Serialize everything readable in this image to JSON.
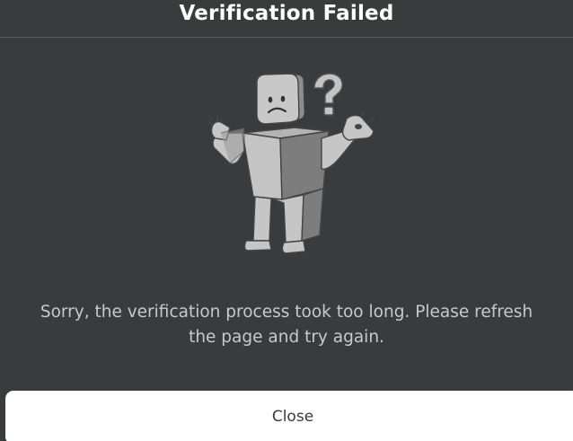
{
  "modal": {
    "title": "Verification Failed",
    "message": "Sorry, the verification process took too long. Please refresh the page and try again.",
    "close_label": "Close",
    "illustration_icon": "confused-robloxian-icon"
  },
  "colors": {
    "background": "#393b3d",
    "title_text": "#ffffff",
    "message_text": "#c8c9ca",
    "button_background": "#ffffff",
    "button_text": "#393b3d"
  }
}
